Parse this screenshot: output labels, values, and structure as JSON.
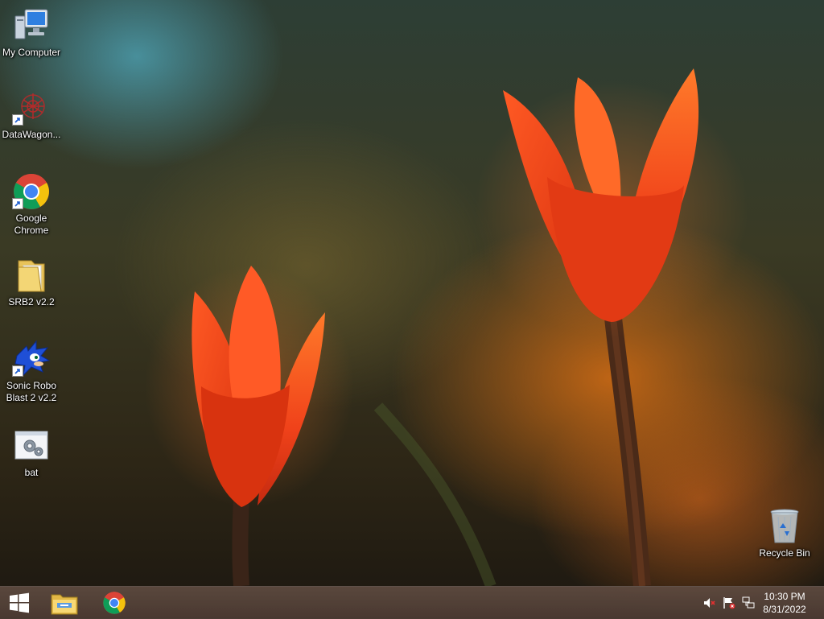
{
  "desktop": {
    "icons": [
      {
        "label": "My Computer",
        "icon": "computer-icon"
      },
      {
        "label": "DataWagon...",
        "icon": "datawagon-icon",
        "shortcut": true
      },
      {
        "label": "Google Chrome",
        "icon": "chrome-icon",
        "shortcut": true
      },
      {
        "label": "SRB2 v2.2",
        "icon": "folder-icon"
      },
      {
        "label": "Sonic Robo Blast 2 v2.2",
        "icon": "sonic-icon",
        "shortcut": true
      },
      {
        "label": "bat",
        "icon": "batch-file-icon"
      },
      {
        "label": "Recycle Bin",
        "icon": "recycle-bin-icon"
      }
    ]
  },
  "taskbar": {
    "start": {
      "icon": "windows-start-icon"
    },
    "pinned": [
      {
        "icon": "file-explorer-icon"
      },
      {
        "icon": "chrome-icon"
      }
    ],
    "tray": {
      "icons": [
        "volume-muted-icon",
        "action-center-flag-icon",
        "network-icon"
      ]
    },
    "clock": {
      "time": "10:30 PM",
      "date": "8/31/2022"
    }
  },
  "colors": {
    "taskbar": "#5f4b41",
    "tulip": "#f0481a",
    "accent_sky": "#50aabe"
  }
}
